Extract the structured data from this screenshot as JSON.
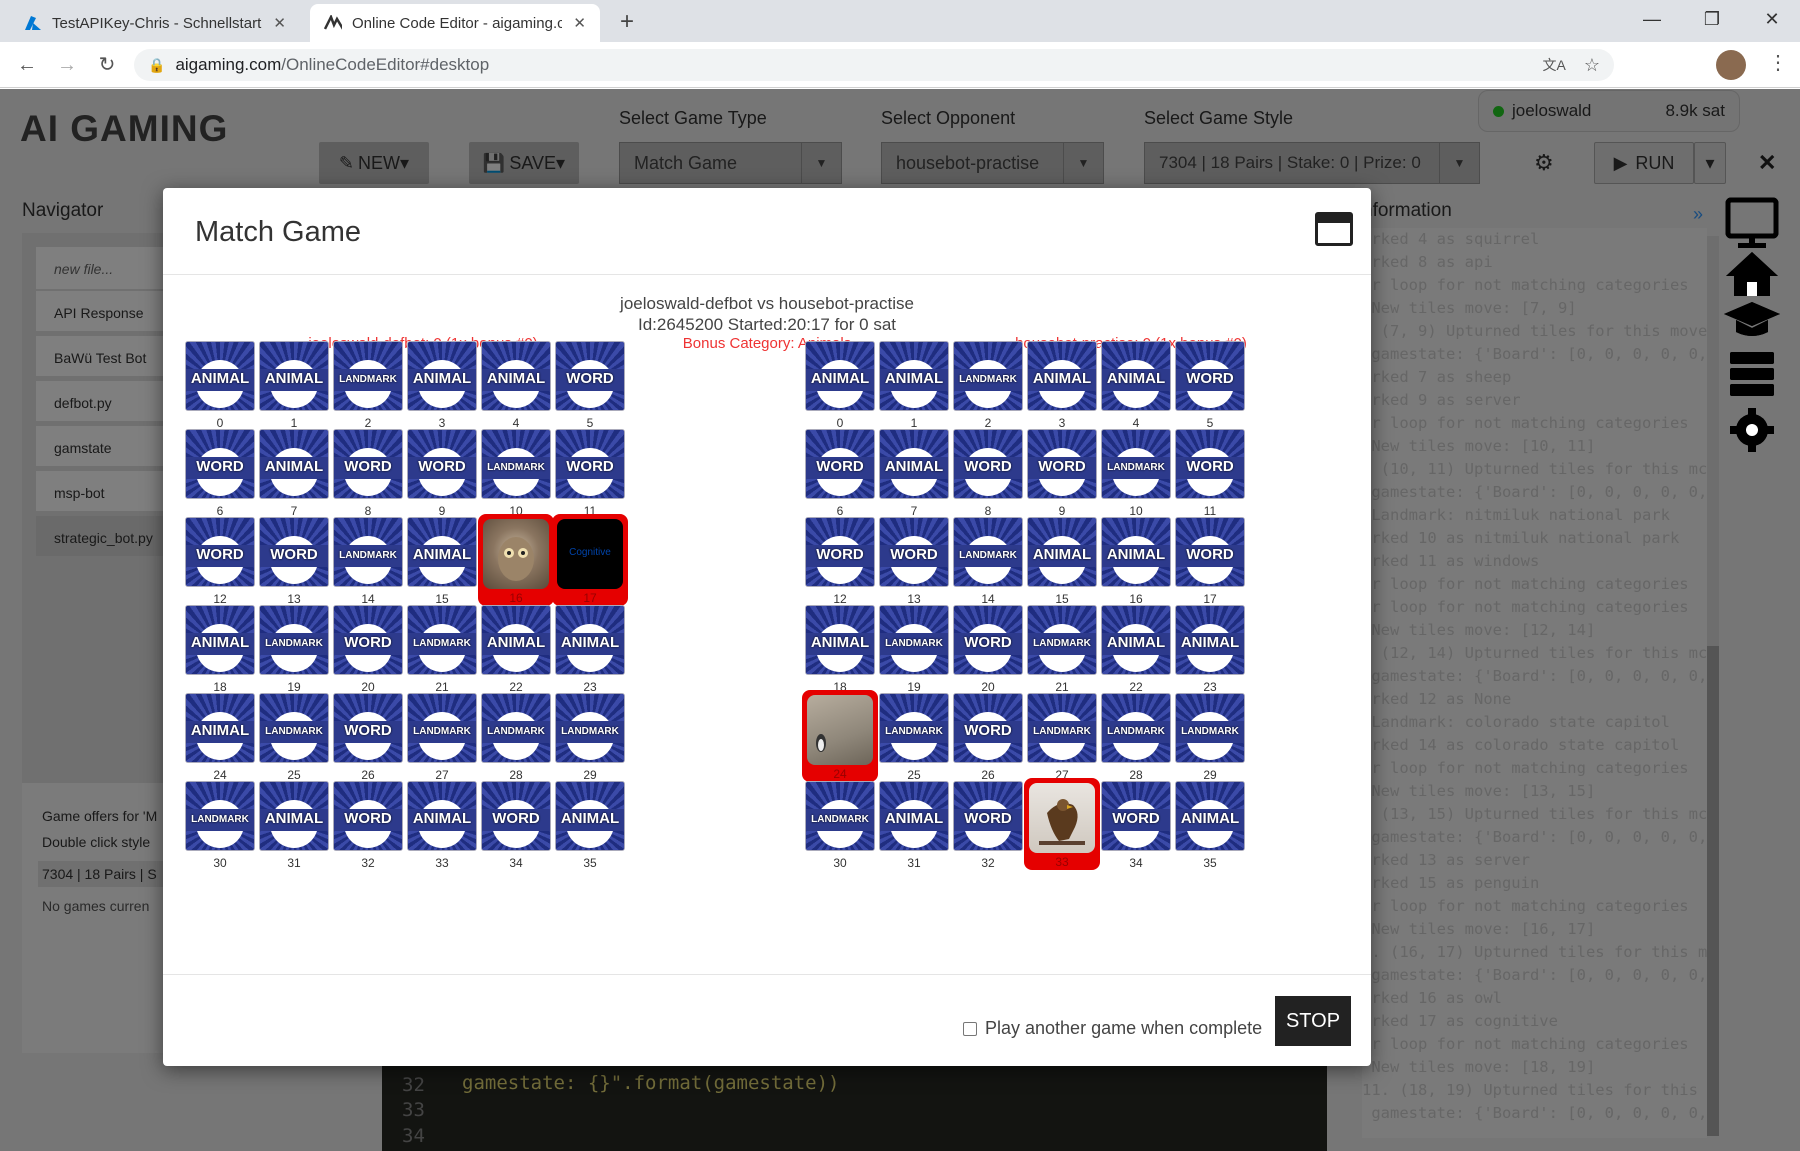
{
  "browser": {
    "tabs": [
      {
        "title": "TestAPIKey-Chris - Schnellstart - ",
        "active": false
      },
      {
        "title": "Online Code Editor - aigaming.co",
        "active": true
      }
    ],
    "url_host": "aigaming.com",
    "url_path": "/OnlineCodeEditor#desktop"
  },
  "app": {
    "logo": "AI GAMING",
    "new_label": "NEW",
    "save_label": "SAVE",
    "game_type_label": "Select Game Type",
    "game_type_value": "Match Game",
    "opponent_label": "Select Opponent",
    "opponent_value": "housebot-practise",
    "style_label": "Select Game Style",
    "style_value": "7304 | 18 Pairs | Stake: 0 | Prize: 0",
    "run_label": "RUN",
    "user": "joeloswald",
    "balance": "8.9k sat",
    "navigator_title": "Navigator",
    "information_title": "nformation",
    "files": [
      "new file...",
      "API Response",
      "BaWü Test Bot",
      "defbot.py",
      "gamstate",
      "msp-bot",
      "strategic_bot.py"
    ],
    "game_offers": "Game offers for 'M",
    "double_click": "Double click style",
    "style_short": "7304 | 18 Pairs | S",
    "no_games": "No games curren",
    "code_lines": [
      {
        "num": "32",
        "text": "gamestate: {}\".format(gamestate))"
      },
      {
        "num": "33",
        "text": ""
      },
      {
        "num": "34",
        "text": ""
      }
    ],
    "log_lines": [
      "arked 4 as squirrel",
      "arked 8 as api",
      "or loop for not matching categories",
      " New tiles move: [7, 9]",
      ". (7, 9) Upturned tiles for this move",
      " gamestate: {'Board': [0, 0, 0, 0, 0,",
      "arked 7 as sheep",
      "arked 9 as server",
      "or loop for not matching categories",
      " New tiles move: [10, 11]",
      ". (10, 11) Upturned tiles for this mc",
      " gamestate: {'Board': [0, 0, 0, 0, 0,",
      " Landmark: nitmiluk national park",
      "arked 10 as nitmiluk national park",
      "arked 11 as windows",
      "or loop for not matching categories",
      "or loop for not matching categories",
      " New tiles move: [12, 14]",
      ". (12, 14) Upturned tiles for this mc",
      " gamestate: {'Board': [0, 0, 0, 0, 0,",
      "arked 12 as None",
      " Landmark: colorado state capitol",
      "arked 14 as colorado state capitol",
      "or loop for not matching categories",
      " New tiles move: [13, 15]",
      ". (13, 15) Upturned tiles for this mc",
      " gamestate: {'Board': [0, 0, 0, 0, 0,",
      "arked 13 as server",
      "arked 15 as penguin",
      "or loop for not matching categories",
      " New tiles move: [16, 17]",
      "0. (16, 17) Upturned tiles for this m",
      " gamestate: {'Board': [0, 0, 0, 0, 0,",
      "arked 16 as owl",
      "arked 17 as cognitive",
      "or loop for not matching categories",
      " New tiles move: [18, 19]",
      "11. (18, 19) Upturned tiles for this m",
      " gamestate: {'Board': [0, 0, 0, 0, 0,"
    ]
  },
  "modal": {
    "title": "Match Game",
    "matchup": "joeloswald-defbot vs housebot-practise",
    "id_line": "Id:2645200   Started:20:17   for 0 sat",
    "left_score": "joeloswald-defbot: 0 (1x bonus #0)",
    "bonus": "Bonus Category: Animals",
    "right_score": "housebot-practise: 0 (1x bonus #0)",
    "play_again": "Play another game when complete",
    "stop_label": "STOP",
    "cognitive_text": "Cognitive",
    "left_board": [
      "ANIMAL",
      "ANIMAL",
      "LANDMARK",
      "ANIMAL",
      "ANIMAL",
      "WORD",
      "WORD",
      "ANIMAL",
      "WORD",
      "WORD",
      "LANDMARK",
      "WORD",
      "WORD",
      "WORD",
      "LANDMARK",
      "ANIMAL",
      "owl",
      "cognitive",
      "ANIMAL",
      "LANDMARK",
      "WORD",
      "LANDMARK",
      "ANIMAL",
      "ANIMAL",
      "ANIMAL",
      "LANDMARK",
      "WORD",
      "LANDMARK",
      "LANDMARK",
      "LANDMARK",
      "LANDMARK",
      "ANIMAL",
      "WORD",
      "ANIMAL",
      "WORD",
      "ANIMAL"
    ],
    "right_board": [
      "ANIMAL",
      "ANIMAL",
      "LANDMARK",
      "ANIMAL",
      "ANIMAL",
      "WORD",
      "WORD",
      "ANIMAL",
      "WORD",
      "WORD",
      "LANDMARK",
      "WORD",
      "WORD",
      "WORD",
      "LANDMARK",
      "ANIMAL",
      "ANIMAL",
      "WORD",
      "ANIMAL",
      "LANDMARK",
      "WORD",
      "LANDMARK",
      "ANIMAL",
      "ANIMAL",
      "penguin",
      "LANDMARK",
      "WORD",
      "LANDMARK",
      "LANDMARK",
      "LANDMARK",
      "LANDMARK",
      "ANIMAL",
      "WORD",
      "eagle",
      "WORD",
      "ANIMAL"
    ]
  }
}
